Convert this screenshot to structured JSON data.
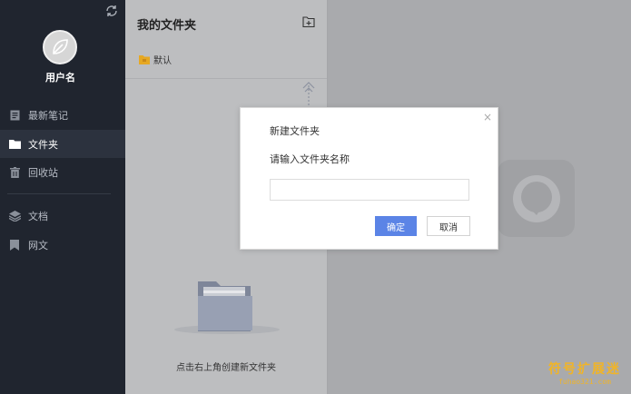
{
  "sidebar": {
    "username": "用户名",
    "items": [
      {
        "label": "最新笔记",
        "icon": "note-icon",
        "active": false
      },
      {
        "label": "文件夹",
        "icon": "folder-icon",
        "active": true
      },
      {
        "label": "回收站",
        "icon": "trash-icon",
        "active": false
      },
      {
        "label": "文档",
        "icon": "layers-icon",
        "active": false
      },
      {
        "label": "网文",
        "icon": "bookmark-icon",
        "active": false
      }
    ]
  },
  "panel": {
    "title": "我的文件夹",
    "folders": [
      {
        "label": "默认"
      }
    ],
    "empty_hint": "点击右上角创建新文件夹"
  },
  "dialog": {
    "title": "新建文件夹",
    "prompt": "请输入文件夹名称",
    "input_value": "",
    "ok_label": "确定",
    "cancel_label": "取消",
    "close_glyph": "×"
  },
  "watermark": {
    "cn": "符号扩展迷",
    "en": "fuhao321.com"
  },
  "colors": {
    "sidebar_bg": "#20252f",
    "accent": "#5b84e6",
    "watermark": "#f0b428"
  }
}
